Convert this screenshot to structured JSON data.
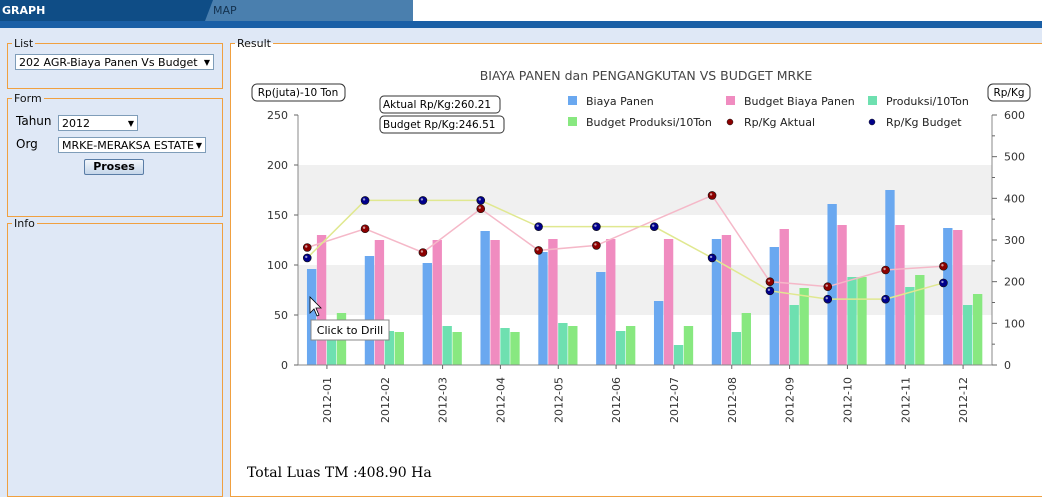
{
  "tabs": {
    "graph": "GRAPH",
    "map": "MAP"
  },
  "panels": {
    "list": "List",
    "form": "Form",
    "info": "Info",
    "result": "Result"
  },
  "list": {
    "selected": "202 AGR-Biaya Panen Vs Budget"
  },
  "form": {
    "tahun_label": "Tahun",
    "tahun_value": "2012",
    "org_label": "Org",
    "org_value": "MRKE-MERAKSA ESTATE",
    "submit_label": "Proses"
  },
  "total_luas": "Total Luas TM :408.90 Ha",
  "tooltip": "Click to Drill",
  "callouts": {
    "aktual": "Aktual Rp/Kg:260.21",
    "budget": "Budget Rp/Kg:246.51"
  },
  "chart_data": {
    "type": "bar",
    "title": "BIAYA PANEN dan PENGANGKUTAN VS BUDGET MRKE",
    "ylabel_left": "Rp(juta)-10 Ton",
    "ylabel_right": "Rp/Kg",
    "ylim_left": [
      0,
      250
    ],
    "ylim_right": [
      0,
      600
    ],
    "yticks_left": [
      "0",
      "50",
      "100",
      "150",
      "200",
      "250"
    ],
    "yticks_right": [
      "0",
      "100",
      "200",
      "300",
      "400",
      "500",
      "600"
    ],
    "categories": [
      "2012-01",
      "2012-02",
      "2012-03",
      "2012-04",
      "2012-05",
      "2012-06",
      "2012-07",
      "2012-08",
      "2012-09",
      "2012-10",
      "2012-11",
      "2012-12"
    ],
    "bar_series": [
      {
        "name": "Biaya Panen",
        "color": "#6aa8f0",
        "values": [
          96,
          109,
          102,
          134,
          113,
          93,
          64,
          126,
          118,
          161,
          175,
          137
        ]
      },
      {
        "name": "Budget Biaya Panen",
        "color": "#f08cc0",
        "values": [
          130,
          125,
          125,
          125,
          126,
          126,
          126,
          130,
          136,
          140,
          140,
          135
        ]
      },
      {
        "name": "Produksi/10Ton",
        "color": "#6ee0b0",
        "values": [
          34,
          34,
          39,
          37,
          42,
          34,
          20,
          33,
          60,
          88,
          78,
          60
        ]
      },
      {
        "name": "Budget Produksi/10Ton",
        "color": "#88e880",
        "values": [
          52,
          33,
          33,
          33,
          39,
          39,
          39,
          52,
          77,
          88,
          90,
          71
        ]
      }
    ],
    "line_series": [
      {
        "name": "Rp/Kg Aktual",
        "color": "#8b0000",
        "line": "#f5b8c8",
        "values": [
          282,
          327,
          270,
          375,
          275,
          287,
          null,
          407,
          200,
          188,
          228,
          237
        ]
      },
      {
        "name": "Rp/Kg Budget",
        "color": "#00008b",
        "line": "#e0e890",
        "values": [
          257,
          395,
          395,
          395,
          332,
          332,
          332,
          257,
          178,
          158,
          158,
          197
        ]
      }
    ],
    "legend_position": "top-right",
    "grid": "alternating bands"
  }
}
